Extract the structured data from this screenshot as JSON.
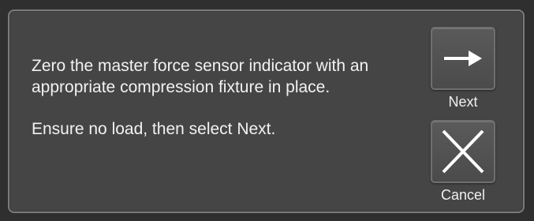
{
  "dialog": {
    "message_line1": "Zero the master force sensor indicator with an appropriate compression fixture in place.",
    "message_line2": "Ensure no load, then select Next."
  },
  "actions": {
    "next_label": "Next",
    "next_icon": "arrow-right-icon",
    "cancel_label": "Cancel",
    "cancel_icon": "close-icon"
  },
  "colors": {
    "dialog_background": "#454545",
    "border": "#7a7a7a",
    "text": "#f2f2f2",
    "icon": "#ffffff"
  }
}
